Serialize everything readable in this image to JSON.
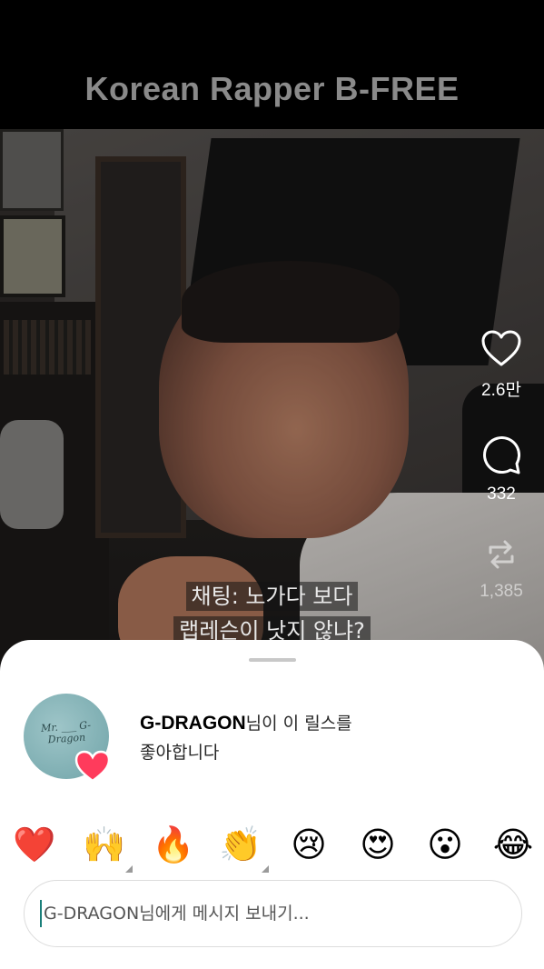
{
  "banner": {
    "title": "Korean Rapper B-FREE"
  },
  "video": {
    "caption_line1": "채팅: 노가다 보다",
    "caption_line2": "랩레슨이 낫지 않냐?"
  },
  "actions": {
    "likes": "2.6만",
    "comments": "332",
    "reposts": "1,385"
  },
  "sheet": {
    "avatar_script": "Mr. ___ G-Dragon",
    "liker_name": "G-DRAGON",
    "like_suffix": "님이 이 릴스를",
    "like_line2": "좋아합니다",
    "reactions": [
      {
        "name": "red-heart-emoji",
        "glyph": "❤️"
      },
      {
        "name": "raising-hands-emoji",
        "glyph": "🙌"
      },
      {
        "name": "fire-emoji",
        "glyph": "🔥"
      },
      {
        "name": "clapping-hands-emoji",
        "glyph": "👏"
      },
      {
        "name": "crying-face-emoji",
        "glyph": "😢"
      },
      {
        "name": "heart-eyes-emoji",
        "glyph": "😍"
      },
      {
        "name": "surprised-face-emoji",
        "glyph": "😮"
      },
      {
        "name": "tears-of-joy-emoji",
        "glyph": "😂"
      }
    ],
    "message_placeholder": "G-DRAGON님에게 메시지 보내기..."
  },
  "colors": {
    "accent_caret": "#1a7f7a",
    "heart_badge": "#ff3b5c"
  }
}
